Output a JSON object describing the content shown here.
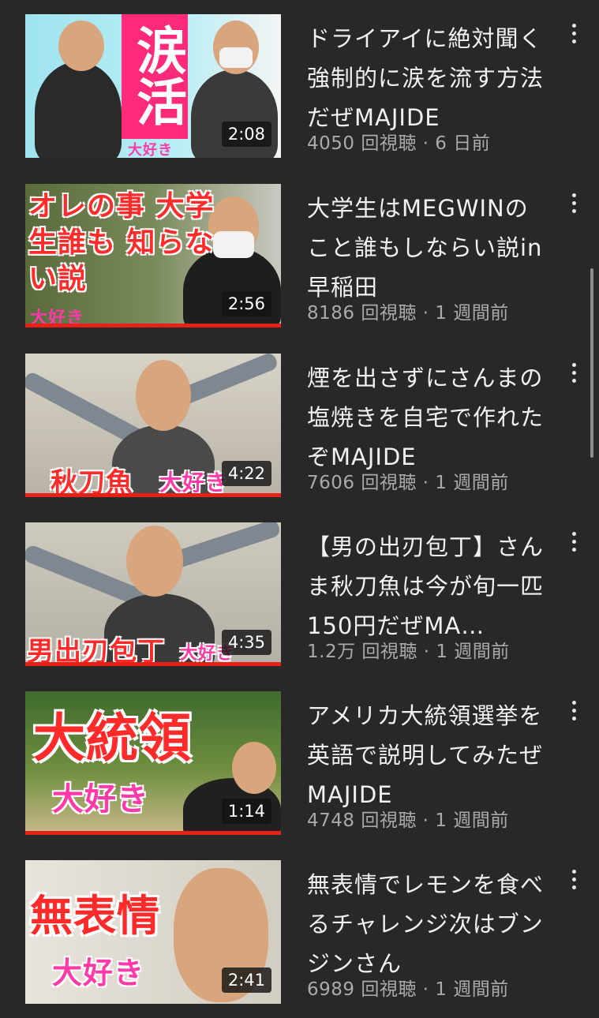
{
  "videos": [
    {
      "title": "ドライアイに絶対聞く強制的に涙を流す方法だぜMAJIDE",
      "meta": "4050 回視聴 · 6 日前",
      "duration": "2:08",
      "thumb_caption_big": "涙活",
      "thumb_caption_small": "大好き"
    },
    {
      "title": "大学生はMEGWINのこと誰もしならい説in早稲田",
      "meta": "8186 回視聴 · 1 週間前",
      "duration": "2:56",
      "thumb_caption_big": "オレの事 大学生誰も 知らない説",
      "thumb_caption_small": "大好き"
    },
    {
      "title": "煙を出さずにさんまの塩焼きを自宅で作れたぞMAJIDE",
      "meta": "7606 回視聴 · 1 週間前",
      "duration": "4:22",
      "thumb_caption_big": "秋刀魚",
      "thumb_caption_small": "大好き"
    },
    {
      "title": "【男の出刃包丁】さんま秋刀魚は今が旬一匹150円だぜMA…",
      "meta": "1.2万 回視聴 · 1 週間前",
      "duration": "4:35",
      "thumb_caption_big": "男出刃包丁",
      "thumb_caption_small": "大好き"
    },
    {
      "title": "アメリカ大統領選挙を英語で説明してみたぜMAJIDE",
      "meta": "4748 回視聴 · 1 週間前",
      "duration": "1:14",
      "thumb_caption_big": "大統領",
      "thumb_caption_small": "大好き"
    },
    {
      "title": "無表情でレモンを食べるチャレンジ次はブンジンさん",
      "meta": "6989 回視聴 · 1 週間前",
      "duration": "2:41",
      "thumb_caption_big": "無表情",
      "thumb_caption_small": "大好き"
    }
  ],
  "icons": {
    "menu": "more-vert-icon"
  },
  "colors": {
    "background": "#282828",
    "title": "#f1f1f1",
    "meta": "#aaaaaa",
    "progress": "#e62117"
  }
}
